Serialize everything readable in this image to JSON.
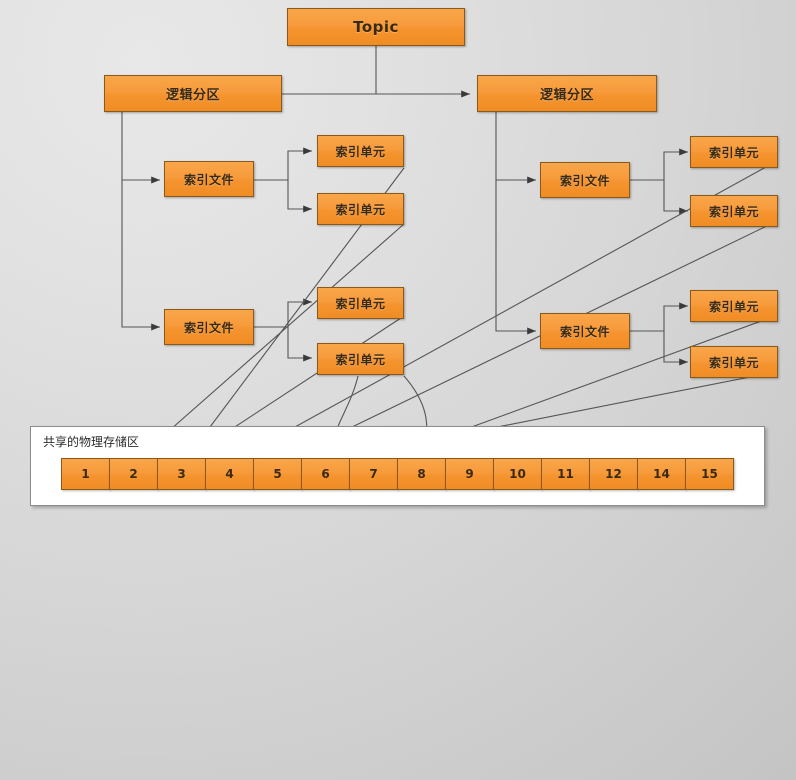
{
  "diagram": {
    "title_node": {
      "label": "Topic"
    },
    "partitions": [
      {
        "label": "逻辑分区"
      },
      {
        "label": "逻辑分区"
      }
    ],
    "index_files": [
      {
        "label": "索引文件"
      },
      {
        "label": "索引文件"
      },
      {
        "label": "索引文件"
      },
      {
        "label": "索引文件"
      }
    ],
    "index_units": [
      {
        "label": "索引单元"
      },
      {
        "label": "索引单元"
      },
      {
        "label": "索引单元"
      },
      {
        "label": "索引单元"
      },
      {
        "label": "索引单元"
      },
      {
        "label": "索引单元"
      },
      {
        "label": "索引单元"
      },
      {
        "label": "索引单元"
      }
    ],
    "storage": {
      "label": "共享的物理存储区",
      "cells": [
        "1",
        "2",
        "3",
        "4",
        "5",
        "6",
        "7",
        "8",
        "9",
        "10",
        "11",
        "12",
        "14",
        "15"
      ]
    },
    "colors": {
      "node_fill_top": "#f8a64a",
      "node_fill_bottom": "#f08c24",
      "node_border": "#8a5a1a",
      "connector": "#555555",
      "storage_bg": "#ffffff",
      "storage_border": "#8c8c8c",
      "background_light": "#e8e8e8",
      "background_dark": "#c4c4c4"
    }
  }
}
